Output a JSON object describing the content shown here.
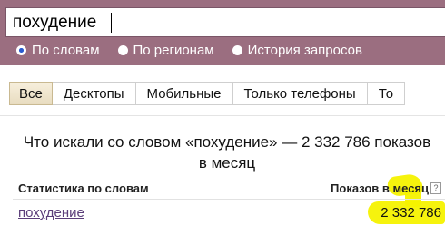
{
  "search": {
    "query": "похудение",
    "options": [
      {
        "label": "По словам",
        "checked": true
      },
      {
        "label": "По регионам",
        "checked": false
      },
      {
        "label": "История запросов",
        "checked": false
      }
    ]
  },
  "tabs": [
    {
      "label": "Все",
      "active": true
    },
    {
      "label": "Десктопы",
      "active": false
    },
    {
      "label": "Мобильные",
      "active": false
    },
    {
      "label": "Только телефоны",
      "active": false
    },
    {
      "label": "То",
      "active": false
    }
  ],
  "result": {
    "heading": "Что искали со словом «похудение» — 2 332 786 показов в месяц"
  },
  "table": {
    "col_phrase": "Статистика по словам",
    "col_impressions": "Показов в месяц",
    "help_icon": "?",
    "rows": [
      {
        "phrase": "похудение",
        "count": "2 332 786"
      }
    ]
  },
  "colors": {
    "header_band": "#9b6e80",
    "link": "#5b3e7a",
    "highlight": "#f6f200",
    "active_tab": "#f0e6cc"
  }
}
